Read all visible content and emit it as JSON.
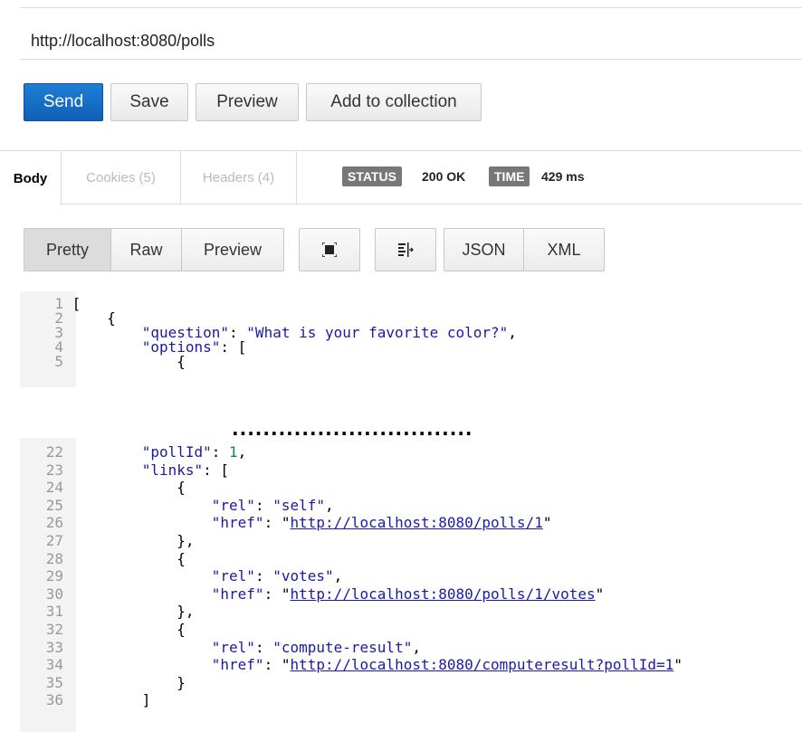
{
  "request": {
    "url": "http://localhost:8080/polls"
  },
  "actions": {
    "send": "Send",
    "save": "Save",
    "preview": "Preview",
    "add_to_collection": "Add to collection"
  },
  "response_tabs": {
    "body": "Body",
    "cookies": "Cookies (5)",
    "headers": "Headers (4)"
  },
  "status": {
    "label": "STATUS",
    "value": "200 OK",
    "time_label": "TIME",
    "time_value": "429 ms"
  },
  "view_modes": [
    "Pretty",
    "Raw",
    "Preview"
  ],
  "active_view_mode": "Pretty",
  "formats": [
    "JSON",
    "XML"
  ],
  "icons": {
    "expand": "expand-icon",
    "wrap": "wrap-lines-icon"
  },
  "ellipsis": "...............................",
  "code_top": [
    {
      "n": "1",
      "text": "["
    },
    {
      "n": "2",
      "text": "    {"
    },
    {
      "n": "3",
      "key": "\"question\"",
      "val": "\"What is your favorite color?\"",
      "tail": ","
    },
    {
      "n": "4",
      "key": "\"options\"",
      "tail": ": ["
    },
    {
      "n": "5",
      "text": "            {"
    }
  ],
  "code_bottom": [
    {
      "n": "22",
      "key": "\"pollId\"",
      "num": "1",
      "tail": ","
    },
    {
      "n": "23",
      "key": "\"links\"",
      "tail": ": ["
    },
    {
      "n": "24",
      "text": "            {"
    },
    {
      "n": "25",
      "key": "\"rel\"",
      "val": "\"self\"",
      "tail": ","
    },
    {
      "n": "26",
      "key": "\"href\"",
      "link": "http://localhost:8080/polls/1"
    },
    {
      "n": "27",
      "text": "            },"
    },
    {
      "n": "28",
      "text": "            {"
    },
    {
      "n": "29",
      "key": "\"rel\"",
      "val": "\"votes\"",
      "tail": ","
    },
    {
      "n": "30",
      "key": "\"href\"",
      "link": "http://localhost:8080/polls/1/votes"
    },
    {
      "n": "31",
      "text": "            },"
    },
    {
      "n": "32",
      "text": "            {"
    },
    {
      "n": "33",
      "key": "\"rel\"",
      "val": "\"compute-result\"",
      "tail": ","
    },
    {
      "n": "34",
      "key": "\"href\"",
      "link": "http://localhost:8080/computeresult?pollId=1"
    },
    {
      "n": "35",
      "text": "            }"
    },
    {
      "n": "36",
      "text": "        ]"
    }
  ]
}
